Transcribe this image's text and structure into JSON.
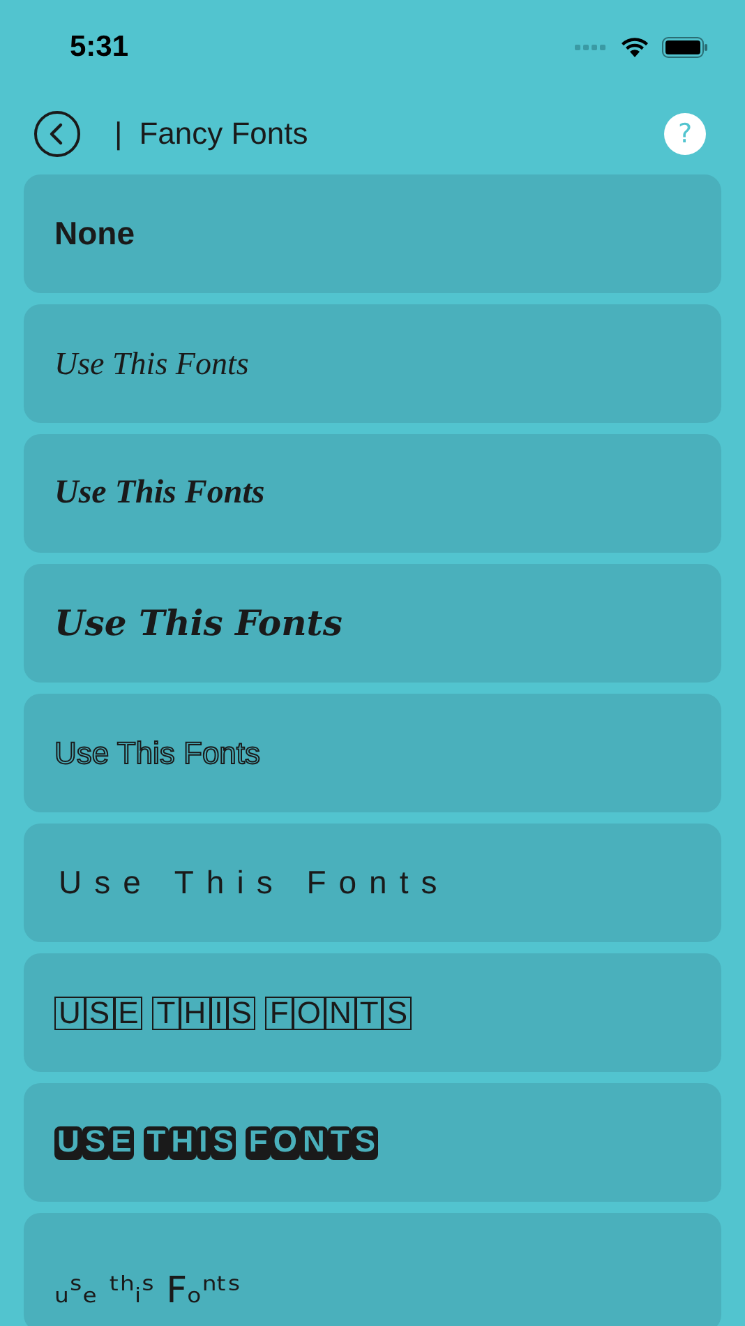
{
  "status_bar": {
    "time": "5:31"
  },
  "header": {
    "title": "Fancy Fonts",
    "separator": "|",
    "help_icon": "?"
  },
  "font_options": [
    {
      "kind": "plain",
      "text": "None"
    },
    {
      "kind": "blackletter",
      "text": "Use This Fonts"
    },
    {
      "kind": "blackletter_bold",
      "text": "Use This Fonts"
    },
    {
      "kind": "script",
      "text": "Use This Fonts"
    },
    {
      "kind": "outline",
      "text": "Use This Fonts"
    },
    {
      "kind": "spaced",
      "text": "Use This Fonts"
    },
    {
      "kind": "squared",
      "text": "USE THIS FONTS"
    },
    {
      "kind": "squared_filled",
      "text": "USE THIS FONTS"
    },
    {
      "kind": "mixed",
      "text": "ᵤˢₑ ᵗʰᵢˢ Fₒⁿᵗˢ"
    }
  ]
}
